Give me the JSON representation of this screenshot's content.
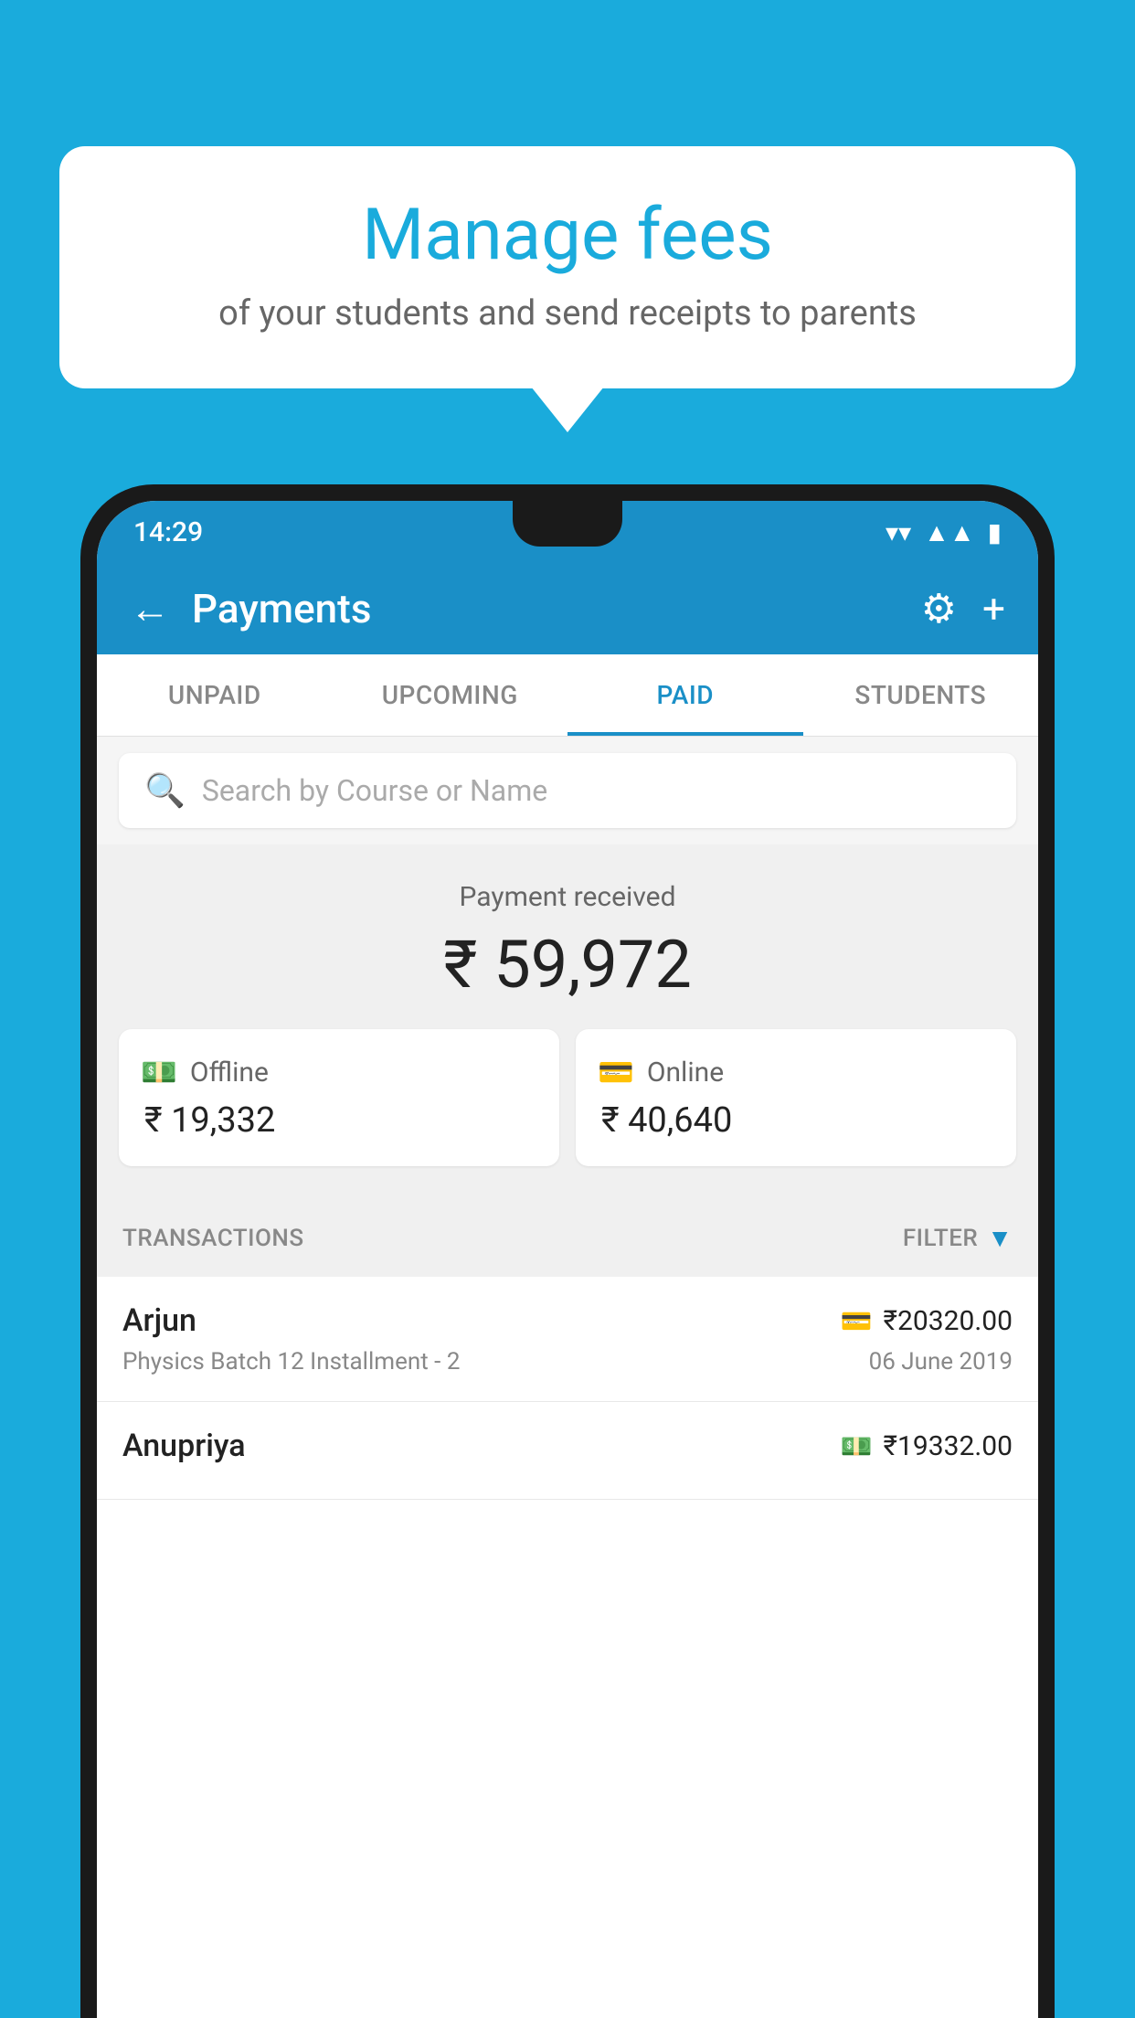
{
  "background_color": "#1aabdc",
  "speech_bubble": {
    "title": "Manage fees",
    "subtitle": "of your students and send receipts to parents"
  },
  "phone": {
    "status_bar": {
      "time": "14:29",
      "wifi": "▼",
      "signal": "▲",
      "battery": "▮"
    },
    "header": {
      "title": "Payments",
      "back_icon": "←",
      "settings_icon": "⚙",
      "add_icon": "+"
    },
    "tabs": [
      {
        "label": "UNPAID",
        "active": false
      },
      {
        "label": "UPCOMING",
        "active": false
      },
      {
        "label": "PAID",
        "active": true
      },
      {
        "label": "STUDENTS",
        "active": false
      }
    ],
    "search": {
      "placeholder": "Search by Course or Name"
    },
    "payment_summary": {
      "label": "Payment received",
      "total": "₹ 59,972",
      "offline": {
        "type": "Offline",
        "amount": "₹ 19,332"
      },
      "online": {
        "type": "Online",
        "amount": "₹ 40,640"
      }
    },
    "transactions": {
      "label": "TRANSACTIONS",
      "filter_label": "FILTER",
      "items": [
        {
          "name": "Arjun",
          "course": "Physics Batch 12 Installment - 2",
          "amount": "₹20320.00",
          "date": "06 June 2019",
          "payment_type": "online"
        },
        {
          "name": "Anupriya",
          "course": "",
          "amount": "₹19332.00",
          "date": "",
          "payment_type": "offline"
        }
      ]
    }
  }
}
